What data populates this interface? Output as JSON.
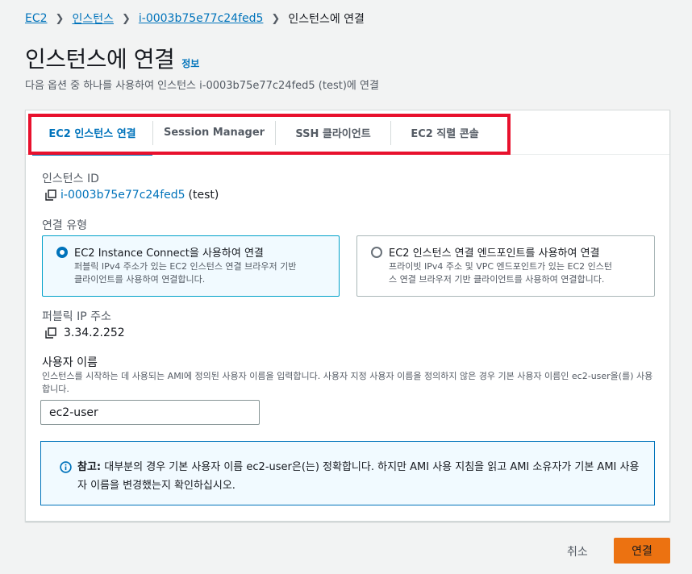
{
  "breadcrumb": {
    "items": [
      "EC2",
      "인스턴스",
      "i-0003b75e77c24fed5"
    ],
    "current": "인스턴스에 연결"
  },
  "header": {
    "title": "인스턴스에 연결",
    "info": "정보",
    "description": "다음 옵션 중 하나를 사용하여 인스턴스 i-0003b75e77c24fed5 (test)에 연결"
  },
  "tabs": [
    {
      "label": "EC2 인스턴스 연결",
      "active": true
    },
    {
      "label": "Session Manager",
      "active": false
    },
    {
      "label": "SSH 클라이언트",
      "active": false
    },
    {
      "label": "EC2 직렬 콘솔",
      "active": false
    }
  ],
  "instance": {
    "label": "인스턴스 ID",
    "id": "i-0003b75e77c24fed5",
    "name": "(test)"
  },
  "connection_type": {
    "label": "연결 유형",
    "options": [
      {
        "title": "EC2 Instance Connect을 사용하여 연결",
        "desc_line1": "퍼블릭 IPv4 주소가 있는 EC2 인스턴스 연결 브라우저 기반",
        "desc_line2": "클라이언트를 사용하여 연결합니다.",
        "selected": true
      },
      {
        "title": "EC2 인스턴스 연결 엔드포인트를 사용하여 연결",
        "desc_line1": "프라이빗 IPv4 주소 및 VPC 엔드포인트가 있는 EC2 인스턴",
        "desc_line2": "스 연결 브라우저 기반 클라이언트를 사용하여 연결합니다.",
        "selected": false
      }
    ]
  },
  "public_ip": {
    "label": "퍼블릭 IP 주소",
    "value": "3.34.2.252"
  },
  "username": {
    "label": "사용자 이름",
    "hint": "인스턴스를 시작하는 데 사용되는 AMI에 정의된 사용자 이름을 입력합니다. 사용자 지정 사용자 이름을 정의하지 않은 경우 기본 사용자 이름인 ec2-user을(를) 사용합니다.",
    "value": "ec2-user"
  },
  "alert": {
    "prefix": "참고:",
    "text": " 대부분의 경우 기본 사용자 이름 ec2-user은(는) 정확합니다. 하지만 AMI 사용 지침을 읽고 AMI 소유자가 기본 AMI 사용자 이름을 변경했는지 확인하십시오."
  },
  "footer": {
    "cancel": "취소",
    "connect": "연결"
  },
  "colors": {
    "link": "#0073bb",
    "primary": "#ec7211",
    "highlight": "#e8112d"
  }
}
